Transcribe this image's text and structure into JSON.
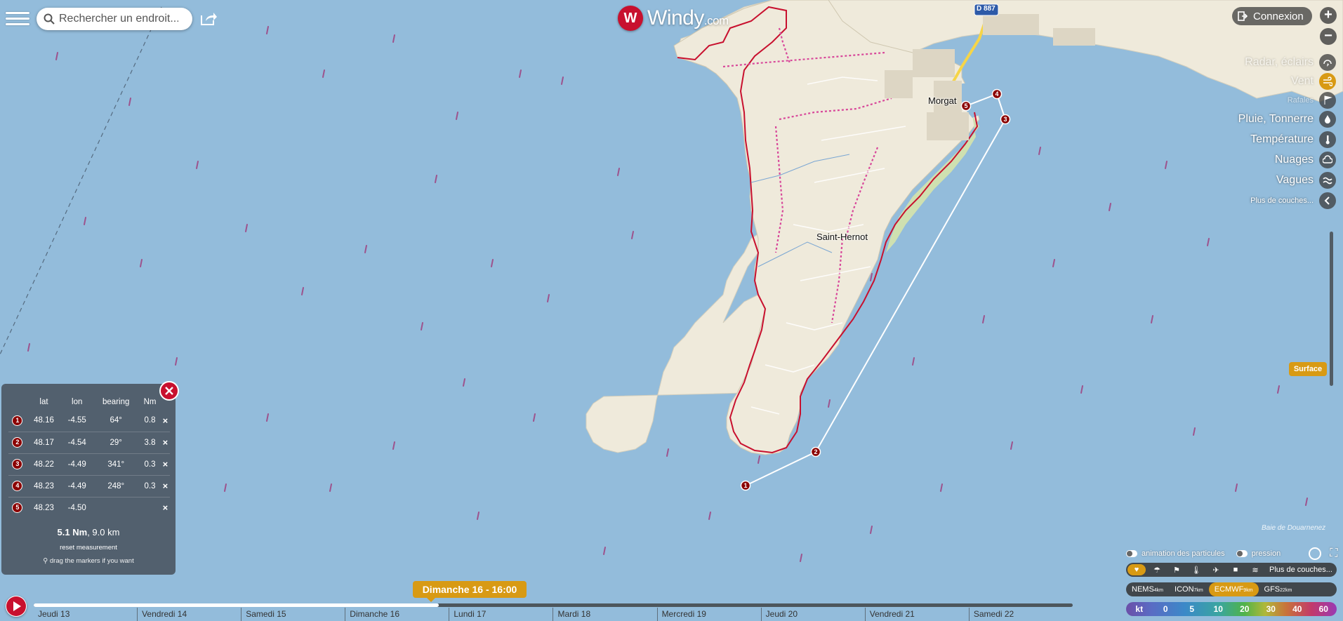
{
  "search": {
    "placeholder": "Rechercher un endroit..."
  },
  "logo": {
    "mark": "W",
    "name": "Windy",
    "suffix": ".com"
  },
  "header": {
    "login_label": "Connexion"
  },
  "zoom": {
    "in_label": "+",
    "out_label": "−"
  },
  "layers": [
    {
      "label": "Radar, éclairs",
      "icon": "radar-icon",
      "active": false,
      "faded": true
    },
    {
      "label": "Vent",
      "icon": "wind-icon",
      "active": true,
      "faded": true
    },
    {
      "label": "Rafales",
      "icon": "gust-icon",
      "active": false,
      "faded": true,
      "small": true
    },
    {
      "label": "Pluie, Tonnerre",
      "icon": "rain-icon",
      "active": false
    },
    {
      "label": "Température",
      "icon": "thermometer-icon",
      "active": false
    },
    {
      "label": "Nuages",
      "icon": "cloud-icon",
      "active": false
    },
    {
      "label": "Vagues",
      "icon": "waves-icon",
      "active": false
    },
    {
      "label": "Plus de couches...",
      "icon": "chevron-left-icon",
      "active": false,
      "small": true
    }
  ],
  "surface_label": "Surface",
  "map": {
    "places": [
      "Morgat",
      "Saint-Hernot"
    ],
    "road": "D 887",
    "bay": "Baie de Douarnenez"
  },
  "measure": {
    "headers": [
      "lat",
      "lon",
      "bearing",
      "Nm"
    ],
    "rows": [
      {
        "n": "1",
        "lat": "48.16",
        "lon": "-4.55",
        "bearing": "64°",
        "nm": "0.8"
      },
      {
        "n": "2",
        "lat": "48.17",
        "lon": "-4.54",
        "bearing": "29°",
        "nm": "3.8"
      },
      {
        "n": "3",
        "lat": "48.22",
        "lon": "-4.49",
        "bearing": "341°",
        "nm": "0.3"
      },
      {
        "n": "4",
        "lat": "48.23",
        "lon": "-4.49",
        "bearing": "248°",
        "nm": "0.3"
      },
      {
        "n": "5",
        "lat": "48.23",
        "lon": "-4.50",
        "bearing": "",
        "nm": ""
      }
    ],
    "delete_label": "×",
    "total_nm": "5.1 Nm",
    "total_km": ", 9.0 km",
    "reset_label": "reset measurement",
    "hint": "drag the markers if you want"
  },
  "options": {
    "particles_label": "animation des particules",
    "pressure_label": "pression"
  },
  "favbar": {
    "more_label": "Plus de couches..."
  },
  "models": [
    {
      "name": "NEMS",
      "res": "4km",
      "active": false
    },
    {
      "name": "ICON",
      "res": "7km",
      "active": false
    },
    {
      "name": "ECMWF",
      "res": "9km",
      "active": true
    },
    {
      "name": "GFS",
      "res": "22km",
      "active": false
    }
  ],
  "scale": {
    "unit": "kt",
    "values": [
      "0",
      "5",
      "10",
      "20",
      "30",
      "40",
      "60"
    ]
  },
  "timeline": {
    "current": "Dimanche 16 - 16:00",
    "progress": 0.39,
    "days": [
      "Jeudi 13",
      "Vendredi 14",
      "Samedi 15",
      "Dimanche 16",
      "Lundi 17",
      "Mardi 18",
      "Mercredi 19",
      "Jeudi 20",
      "Vendredi 21",
      "Samedi 22"
    ]
  },
  "colors": {
    "accent": "#d89a14",
    "danger": "#c8102e",
    "sea": "#93bcdb",
    "land": "#efeadb",
    "trail": "#c8102e"
  }
}
